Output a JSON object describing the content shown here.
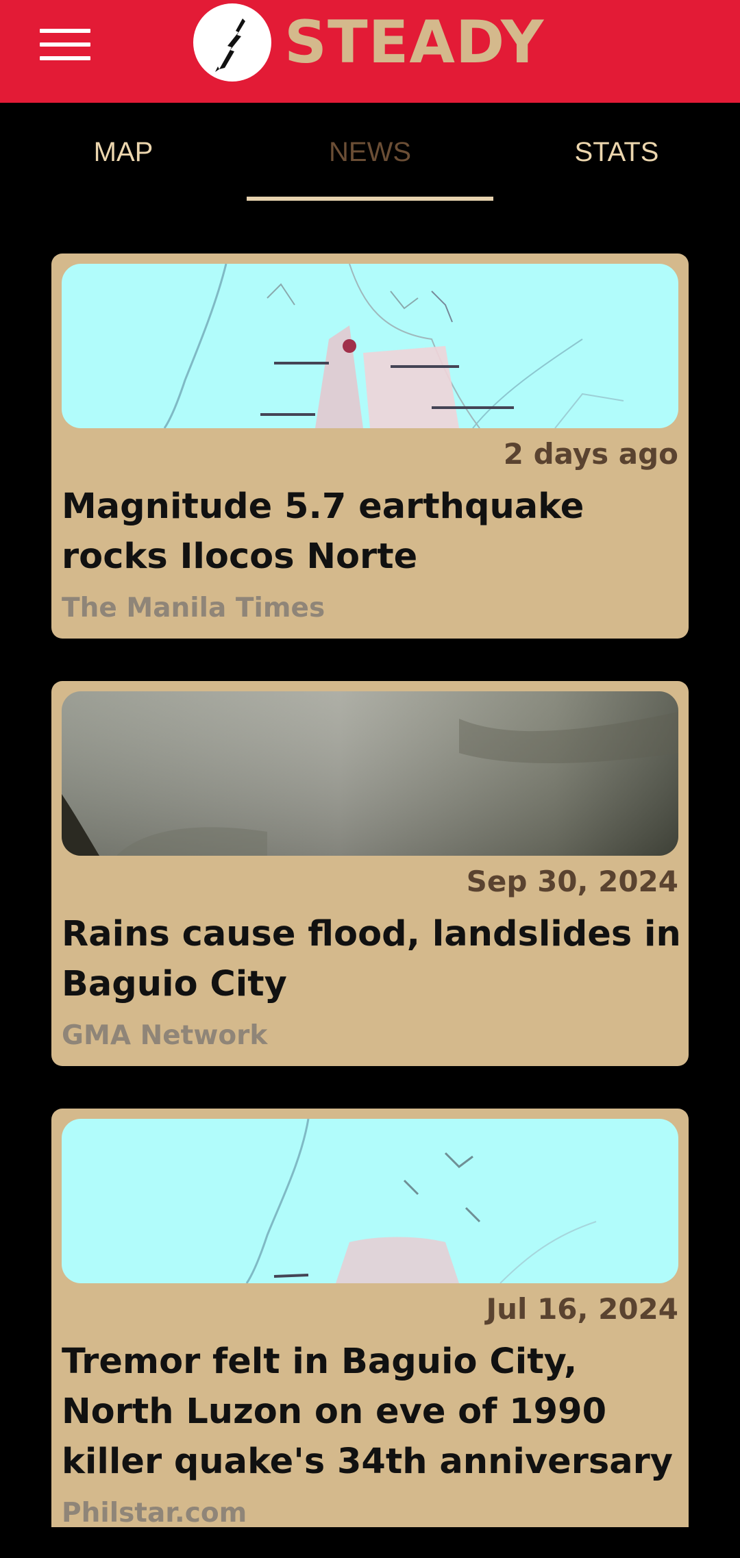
{
  "app": {
    "title": "STEADY",
    "menu_icon": "hamburger-menu-icon",
    "logo_icon": "crack-logo-icon",
    "colors": {
      "appbar": "#e31b36",
      "accent": "#d4b98c",
      "background": "#000000"
    }
  },
  "tabs": [
    {
      "label": "MAP"
    },
    {
      "label": "NEWS",
      "active": true
    },
    {
      "label": "STATS"
    }
  ],
  "news": [
    {
      "date": "2 days ago",
      "title": "Magnitude 5.7 earthquake rocks Ilocos Norte",
      "source": "The Manila Times",
      "image": "seismic-map-thumbnail"
    },
    {
      "date": "Sep 30, 2024",
      "title": "Rains cause flood, landslides in Baguio City",
      "source": "GMA Network",
      "image": "flood-photo-thumbnail"
    },
    {
      "date": "Jul 16, 2024",
      "title": "Tremor felt in Baguio City, North Luzon on eve of 1990 killer quake's 34th anniversary",
      "source": "Philstar.com",
      "image": "seismic-map-thumbnail"
    }
  ]
}
